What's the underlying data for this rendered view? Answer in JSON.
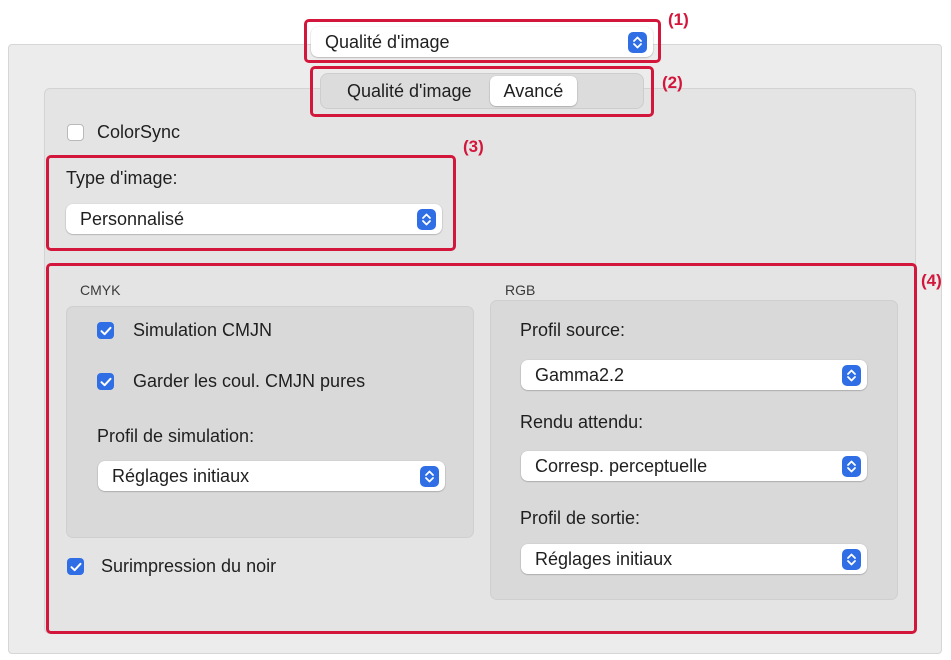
{
  "header": {
    "print_options_menu": "Qualité d'image"
  },
  "tabs": [
    {
      "label": "Qualité d'image",
      "active": false
    },
    {
      "label": "Avancé",
      "active": true
    }
  ],
  "colorsync": {
    "label": "ColorSync",
    "checked": false
  },
  "image_type": {
    "label": "Type d'image:",
    "value": "Personnalisé"
  },
  "cmyk": {
    "title": "CMYK",
    "simulation": {
      "label": "Simulation CMJN",
      "checked": true
    },
    "keep_pure": {
      "label": "Garder les coul. CMJN pures",
      "checked": true
    },
    "profile_label": "Profil de simulation:",
    "profile_value": "Réglages initiaux"
  },
  "black_overprint": {
    "label": "Surimpression du noir",
    "checked": true
  },
  "rgb": {
    "title": "RGB",
    "source_label": "Profil source:",
    "source_value": "Gamma2.2",
    "intent_label": "Rendu attendu:",
    "intent_value": "Corresp. perceptuelle",
    "output_label": "Profil de sortie:",
    "output_value": "Réglages initiaux"
  },
  "callouts": [
    "(1)",
    "(2)",
    "(3)",
    "(4)"
  ],
  "colors": {
    "accent": "#2f6ee5",
    "callout": "#d3163b"
  }
}
